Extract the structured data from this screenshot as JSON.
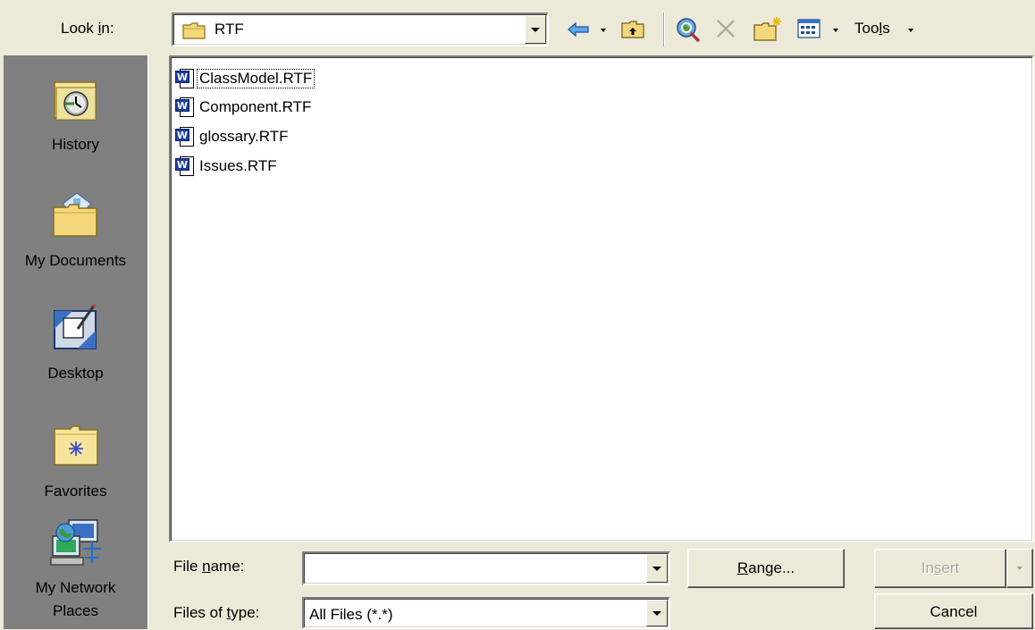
{
  "look_in": {
    "label_pre": "Look ",
    "label_key": "i",
    "label_post": "n:",
    "value": "RTF"
  },
  "toolbar": {
    "icons": [
      "back-arrow-icon",
      "up-folder-icon",
      "search-web-icon",
      "delete-icon",
      "new-folder-icon",
      "views-icon"
    ],
    "tools_pre": "Too",
    "tools_key": "l",
    "tools_post": "s"
  },
  "places": [
    {
      "label": "History",
      "icon": "history-icon"
    },
    {
      "label": "My Documents",
      "icon": "my-documents-icon"
    },
    {
      "label": "Desktop",
      "icon": "desktop-icon"
    },
    {
      "label": "Favorites",
      "icon": "favorites-icon"
    },
    {
      "label_line1": "My Network",
      "label_line2": "Places",
      "icon": "network-places-icon"
    }
  ],
  "files": [
    {
      "name": "ClassModel.RTF"
    },
    {
      "name": "Component.RTF"
    },
    {
      "name": "glossary.RTF"
    },
    {
      "name": "Issues.RTF"
    }
  ],
  "file_name": {
    "label_pre": "File ",
    "label_key": "n",
    "label_post": "ame:",
    "value": ""
  },
  "files_of_type": {
    "label_pre": "Files of ",
    "label_key": "t",
    "label_post": "ype:",
    "value": "All Files (*.*)"
  },
  "buttons": {
    "range_key": "R",
    "range_rest": "ange...",
    "insert_pre": "In",
    "insert_key": "s",
    "insert_post": "ert",
    "cancel": "Cancel"
  }
}
